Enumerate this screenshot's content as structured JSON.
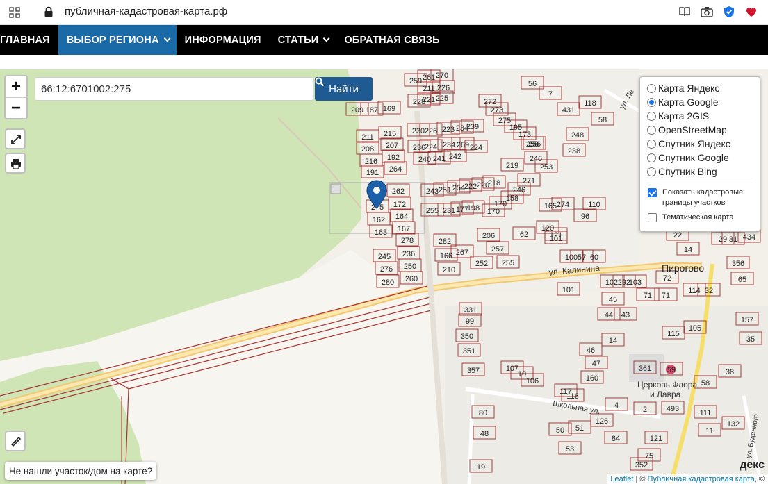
{
  "browser": {
    "url": "публичная-кадастровая-карта.рф",
    "icons": [
      "apps-icon",
      "lock-icon",
      "reader-icon",
      "camera-icon",
      "shield-icon",
      "heart-icon"
    ]
  },
  "nav": {
    "items": [
      {
        "label": "ГЛАВНАЯ",
        "dropdown": false,
        "active": false
      },
      {
        "label": "ВЫБОР РЕГИОНА",
        "dropdown": true,
        "active": true
      },
      {
        "label": "ИНФОРМАЦИЯ",
        "dropdown": false,
        "active": false
      },
      {
        "label": "СТАТЬИ",
        "dropdown": true,
        "active": false
      },
      {
        "label": "ОБРАТНАЯ СВЯЗЬ",
        "dropdown": false,
        "active": false
      }
    ]
  },
  "map": {
    "zoom_in": "+",
    "zoom_out": "−",
    "search_value": "66:12:6701002:275",
    "search_button": "Найти",
    "layers": [
      {
        "label": "Карта Яндекс",
        "selected": false
      },
      {
        "label": "Карта Google",
        "selected": true
      },
      {
        "label": "Карта 2GIS",
        "selected": false
      },
      {
        "label": "OpenStreetMap",
        "selected": false
      },
      {
        "label": "Спутник Яндекс",
        "selected": false
      },
      {
        "label": "Спутник Google",
        "selected": false
      },
      {
        "label": "Спутник Bing",
        "selected": false
      }
    ],
    "overlays": [
      {
        "label": "Показать кадастровые границы участков",
        "checked": true
      },
      {
        "label": "Тематическая карта",
        "checked": false
      }
    ],
    "not_found": "Не нашли участок/дом на карте?",
    "attribution_leaflet": "Leaflet",
    "attribution_sep": " | © ",
    "attribution_source": "Публичная кадастровая карта",
    "attribution_tail": ", ©",
    "watermark": "декс",
    "labels": {
      "village": "Пирогово",
      "street_kalinina": "ул. Калинина",
      "street_school": "Школьная ул.",
      "street_len": "ул. Ле",
      "street_budennogo": "ул. Буденного",
      "church": "Церковь Флора\nи Лавра"
    },
    "parcels": [
      [
        "275",
        543,
        300
      ],
      [
        "262",
        573,
        277
      ],
      [
        "172",
        575,
        296
      ],
      [
        "162",
        545,
        318
      ],
      [
        "164",
        578,
        313
      ],
      [
        "163",
        548,
        336
      ],
      [
        "167",
        581,
        331
      ],
      [
        "278",
        586,
        348
      ],
      [
        "245",
        553,
        371
      ],
      [
        "236",
        588,
        367
      ],
      [
        "276",
        556,
        389
      ],
      [
        "250",
        590,
        385
      ],
      [
        "280",
        558,
        408
      ],
      [
        "260",
        592,
        403
      ],
      [
        "211",
        529,
        199
      ],
      [
        "215",
        561,
        194
      ],
      [
        "208",
        529,
        216
      ],
      [
        "207",
        564,
        211
      ],
      [
        "216",
        534,
        234
      ],
      [
        "192",
        566,
        228
      ],
      [
        "191",
        536,
        250
      ],
      [
        "264",
        569,
        245
      ],
      [
        "209",
        514,
        160
      ],
      [
        "187",
        535,
        160
      ],
      [
        "169",
        560,
        158
      ],
      [
        "259",
        598,
        118
      ],
      [
        "261",
        617,
        113
      ],
      [
        "270",
        636,
        110
      ],
      [
        "228",
        603,
        148
      ],
      [
        "221",
        617,
        145
      ],
      [
        "225",
        636,
        143
      ],
      [
        "211",
        617,
        129
      ],
      [
        "226",
        638,
        128
      ],
      [
        "230",
        602,
        190
      ],
      [
        "226",
        620,
        190
      ],
      [
        "223",
        645,
        188
      ],
      [
        "234",
        665,
        186
      ],
      [
        "239",
        680,
        184
      ],
      [
        "236",
        603,
        214
      ],
      [
        "224",
        620,
        213
      ],
      [
        "234",
        646,
        210
      ],
      [
        "269",
        666,
        210
      ],
      [
        "240",
        611,
        231
      ],
      [
        "241",
        632,
        230
      ],
      [
        "242",
        655,
        227
      ],
      [
        "224",
        685,
        214
      ],
      [
        "243",
        622,
        277
      ],
      [
        "251",
        640,
        275
      ],
      [
        "254",
        660,
        272
      ],
      [
        "222",
        677,
        270
      ],
      [
        "220",
        695,
        268
      ],
      [
        "218",
        711,
        265
      ],
      [
        "219",
        737,
        240
      ],
      [
        "271",
        761,
        262
      ],
      [
        "255",
        622,
        305
      ],
      [
        "231",
        646,
        305
      ],
      [
        "177",
        665,
        303
      ],
      [
        "198",
        681,
        301
      ],
      [
        "170",
        720,
        295
      ],
      [
        "158",
        737,
        287
      ],
      [
        "246",
        747,
        275
      ],
      [
        "282",
        640,
        349
      ],
      [
        "267",
        665,
        365
      ],
      [
        "206",
        703,
        341
      ],
      [
        "257",
        716,
        360
      ],
      [
        "255",
        731,
        380
      ],
      [
        "252",
        693,
        381
      ],
      [
        "166",
        642,
        370
      ],
      [
        "210",
        646,
        390
      ],
      [
        "165",
        792,
        298
      ],
      [
        "274",
        810,
        296
      ],
      [
        "96",
        842,
        313
      ],
      [
        "110",
        855,
        296
      ],
      [
        "120",
        788,
        330
      ],
      [
        "121",
        800,
        340
      ],
      [
        "62",
        754,
        339
      ],
      [
        "56",
        766,
        122
      ],
      [
        "7",
        792,
        137
      ],
      [
        "431",
        818,
        160
      ],
      [
        "118",
        849,
        150
      ],
      [
        "58",
        867,
        174
      ],
      [
        "248",
        831,
        196
      ],
      [
        "238",
        826,
        219
      ],
      [
        "256",
        769,
        209
      ],
      [
        "253",
        786,
        242
      ],
      [
        "272",
        705,
        148
      ],
      [
        "273",
        715,
        160
      ],
      [
        "275",
        726,
        175
      ],
      [
        "195",
        742,
        185
      ],
      [
        "173",
        755,
        195
      ],
      [
        "258",
        766,
        209
      ],
      [
        "246",
        771,
        230
      ],
      [
        "331",
        677,
        448
      ],
      [
        "99",
        676,
        464
      ],
      [
        "350",
        672,
        486
      ],
      [
        "351",
        675,
        507
      ],
      [
        "357",
        681,
        535
      ],
      [
        "107",
        737,
        532
      ],
      [
        "10",
        751,
        540
      ],
      [
        "106",
        766,
        550
      ],
      [
        "117",
        814,
        565
      ],
      [
        "116",
        824,
        572
      ],
      [
        "160",
        852,
        546
      ],
      [
        "47",
        858,
        525
      ],
      [
        "46",
        850,
        506
      ],
      [
        "14",
        882,
        492
      ],
      [
        "50",
        806,
        621
      ],
      [
        "53",
        820,
        648
      ],
      [
        "51",
        834,
        618
      ],
      [
        "126",
        866,
        608
      ],
      [
        "84",
        886,
        633
      ],
      [
        "121",
        944,
        633
      ],
      [
        "493",
        968,
        590
      ],
      [
        "4",
        887,
        585
      ],
      [
        "2",
        928,
        591
      ],
      [
        "75",
        934,
        658
      ],
      [
        "352",
        923,
        671
      ],
      [
        "115",
        969,
        482
      ],
      [
        "105",
        1000,
        474
      ],
      [
        "114",
        999,
        420
      ],
      [
        "32",
        1020,
        420
      ],
      [
        "65",
        1068,
        404
      ],
      [
        "356",
        1062,
        381
      ],
      [
        "157",
        1075,
        462
      ],
      [
        "35",
        1080,
        490
      ],
      [
        "38",
        1050,
        537
      ],
      [
        "111",
        1015,
        596
      ],
      [
        "132",
        1055,
        612
      ],
      [
        "11",
        1021,
        622
      ],
      [
        "59",
        966,
        534
      ],
      [
        "361",
        928,
        532
      ],
      [
        "58",
        1015,
        553
      ],
      [
        "80",
        695,
        596
      ],
      [
        "48",
        697,
        626
      ],
      [
        "19",
        692,
        674
      ],
      [
        "14",
        990,
        361
      ],
      [
        "22",
        975,
        340
      ],
      [
        "29",
        1040,
        346
      ],
      [
        "434",
        1078,
        343
      ],
      [
        "31",
        1055,
        346
      ],
      [
        "45",
        882,
        433
      ],
      [
        "44",
        876,
        455
      ],
      [
        "43",
        900,
        455
      ],
      [
        "71",
        932,
        427
      ],
      [
        "102",
        880,
        408
      ],
      [
        "292",
        898,
        408
      ],
      [
        "103",
        914,
        408
      ],
      [
        "72",
        960,
        402
      ],
      [
        "71",
        958,
        427
      ],
      [
        "101",
        818,
        419
      ],
      [
        "100",
        822,
        372
      ],
      [
        "60",
        855,
        372
      ],
      [
        "57",
        837,
        372
      ],
      [
        "101",
        800,
        345
      ],
      [
        "170",
        710,
        306
      ]
    ]
  }
}
